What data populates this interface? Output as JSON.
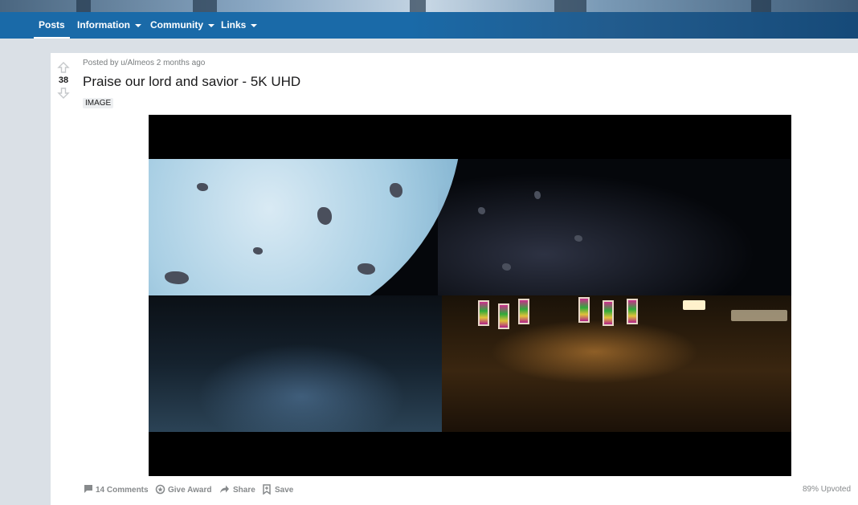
{
  "nav": {
    "items": [
      {
        "label": "Posts",
        "active": true,
        "dropdown": false
      },
      {
        "label": "Information",
        "active": false,
        "dropdown": true
      },
      {
        "label": "Community",
        "active": false,
        "dropdown": true
      },
      {
        "label": "Links",
        "active": false,
        "dropdown": true
      }
    ]
  },
  "post": {
    "score": "38",
    "meta_prefix": "Posted by",
    "author": "u/Almeos",
    "age": "2 months ago",
    "title": "Praise our lord and savior - 5K UHD",
    "flair": "IMAGE"
  },
  "actions": {
    "comments": "14 Comments",
    "award": "Give Award",
    "share": "Share",
    "save": "Save",
    "upvoted": "89% Upvoted"
  },
  "icons": {
    "upvote": "upvote-arrow-icon",
    "downvote": "downvote-arrow-icon",
    "comments": "comment-bubble-icon",
    "award": "award-icon",
    "share": "share-arrow-icon",
    "save": "bookmark-icon"
  },
  "colors": {
    "nav_bg": "#1a6aa8",
    "page_bg": "#dae0e6",
    "text_muted": "#878a8c"
  }
}
